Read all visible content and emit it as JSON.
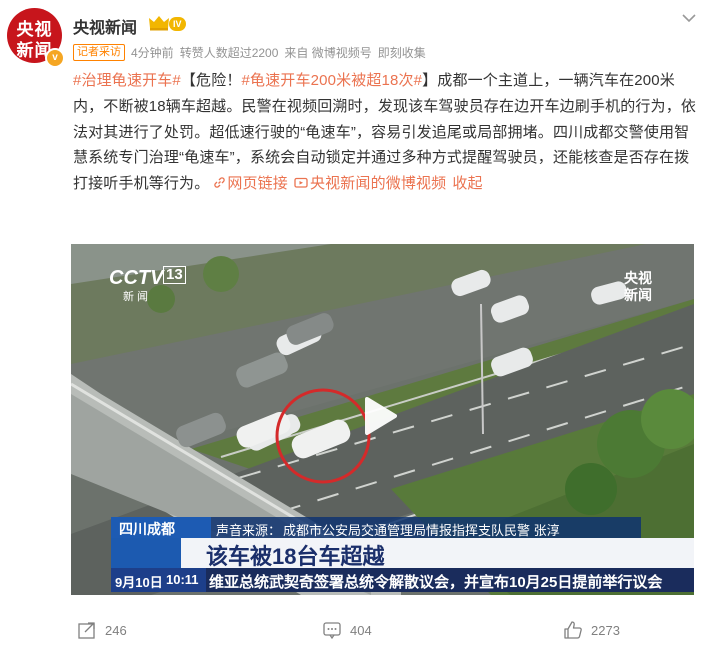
{
  "header": {
    "avatar_line1": "央视",
    "avatar_line2": "新闻",
    "verified_mark": "v",
    "username": "央视新闻",
    "level_badge": "IV",
    "more_icon": "chevron-down-icon"
  },
  "meta": {
    "tag": "记者采访",
    "time": "4分钟前",
    "reposts_info": "转赞人数超过2200",
    "source": "来自 微博视频号",
    "collect": "即刻收集"
  },
  "post": {
    "topic1": "#治理龟速开车#",
    "danger": "【危险！",
    "topic2": "#龟速开车200米被超18次#",
    "text1": "】成都一个主道上，一辆汽车在200米内，不断被18辆车超越。民警在视频回溯时，发现该车驾驶员存在边开车边刷手机的行为，依法对其进行了处罚。超低速行驶的“龟速车”，容易引发追尾或局部拥堵。四川成都交警使用智慧系统专门治理“龟速车”，系统会自动锁定并通过多种方式提醒驾驶员，还能核查是否存在拨打接听手机等行为。",
    "link_web": "网页链接",
    "link_video": "央视新闻的微博视频",
    "collapse": "收起"
  },
  "video": {
    "cctv_channel": "13",
    "cctv_sub": "新 闻",
    "watermark_line1": "央视",
    "watermark_line2": "新闻",
    "location": "四川成都",
    "source_label": "声音来源：",
    "source_text": "成都市公安局交通管理局情报指挥支队民警 张淳",
    "headline": "该车被18台车超越",
    "date": "9月10日",
    "time": "10:11",
    "ticker": "维亚总统武契奇签署总统令解散议会，并宣布10月25日提前举行议会"
  },
  "actions": {
    "repost_count": "246",
    "comment_count": "404",
    "like_count": "2273"
  },
  "colors": {
    "brand_red": "#c7151c",
    "link_orange": "#eb7350",
    "tag_orange": "#ff8200",
    "gray_text": "#939393"
  }
}
